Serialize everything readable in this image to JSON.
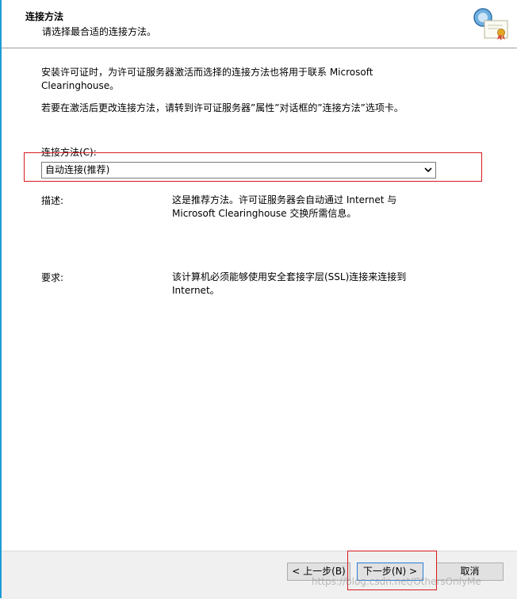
{
  "header": {
    "title": "连接方法",
    "subtitle": "请选择最合适的连接方法。",
    "icon": "certificate-icon"
  },
  "content": {
    "intro_line1": "安装许可证时，为许可证服务器激活而选择的连接方法也将用于联系 Microsoft Clearinghouse。",
    "intro_line2": "若要在激活后更改连接方法，请转到许可证服务器”属性”对话框的”连接方法”选项卡。",
    "method_label": "连接方法(C):",
    "method_selected": "自动连接(推荐)",
    "description_label": "描述:",
    "description_text": "这是推荐方法。许可证服务器会自动通过 Internet 与 Microsoft Clearinghouse 交换所需信息。",
    "requirements_label": "要求:",
    "requirements_text": "该计算机必须能够使用安全套接字层(SSL)连接来连接到 Internet。"
  },
  "footer": {
    "back_label": "< 上一步(B)",
    "next_label": "下一步(N) >",
    "cancel_label": "取消"
  },
  "watermark": "https://blog.csdn.net/OthersOnlyMe",
  "colors": {
    "accent": "#1e9bd7",
    "highlight": "#d7191f",
    "footer_bg": "#f0f0f0"
  }
}
